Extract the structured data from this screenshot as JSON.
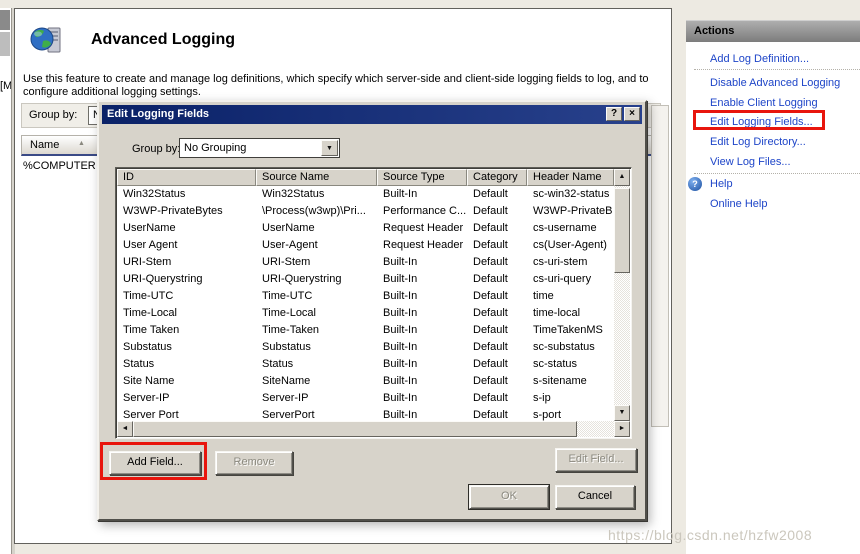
{
  "page": {
    "title": "Advanced Logging",
    "description_line1": "Use this feature to create and manage log definitions, which specify which server-side and client-side logging fields to log, and to",
    "description_line2": "configure additional logging settings.",
    "background": {
      "toolbar_label": "Group by:",
      "toolbar_value_partial": "N",
      "list_header": "Name",
      "first_row": "%COMPUTER",
      "tree_fragment": "[M"
    }
  },
  "dialog": {
    "title": "Edit Logging Fields",
    "group_by_label": "Group by:",
    "group_by_value": "No Grouping",
    "table": {
      "columns": [
        "ID",
        "Source Name",
        "Source Type",
        "Category",
        "Header Name"
      ],
      "rows": [
        [
          "Win32Status",
          "Win32Status",
          "Built-In",
          "Default",
          "sc-win32-status"
        ],
        [
          "W3WP-PrivateBytes",
          "\\Process(w3wp)\\Pri...",
          "Performance C...",
          "Default",
          "W3WP-PrivateB"
        ],
        [
          "UserName",
          "UserName",
          "Request Header",
          "Default",
          "cs-username"
        ],
        [
          "User Agent",
          "User-Agent",
          "Request Header",
          "Default",
          "cs(User-Agent)"
        ],
        [
          "URI-Stem",
          "URI-Stem",
          "Built-In",
          "Default",
          "cs-uri-stem"
        ],
        [
          "URI-Querystring",
          "URI-Querystring",
          "Built-In",
          "Default",
          "cs-uri-query"
        ],
        [
          "Time-UTC",
          "Time-UTC",
          "Built-In",
          "Default",
          "time"
        ],
        [
          "Time-Local",
          "Time-Local",
          "Built-In",
          "Default",
          "time-local"
        ],
        [
          "Time Taken",
          "Time-Taken",
          "Built-In",
          "Default",
          "TimeTakenMS"
        ],
        [
          "Substatus",
          "Substatus",
          "Built-In",
          "Default",
          "sc-substatus"
        ],
        [
          "Status",
          "Status",
          "Built-In",
          "Default",
          "sc-status"
        ],
        [
          "Site Name",
          "SiteName",
          "Built-In",
          "Default",
          "s-sitename"
        ],
        [
          "Server-IP",
          "Server-IP",
          "Built-In",
          "Default",
          "s-ip"
        ],
        [
          "Server Port",
          "ServerPort",
          "Built-In",
          "Default",
          "s-port"
        ]
      ]
    },
    "buttons": {
      "add_field": "Add Field...",
      "remove": "Remove",
      "edit_field": "Edit Field...",
      "ok": "OK",
      "cancel": "Cancel"
    }
  },
  "actions": {
    "header": "Actions",
    "add_log_definition": "Add Log Definition...",
    "disable_advanced_logging": "Disable Advanced Logging",
    "enable_client_logging": "Enable Client Logging",
    "edit_logging_fields": "Edit Logging Fields...",
    "edit_log_directory": "Edit Log Directory...",
    "view_log_files": "View Log Files...",
    "help": "Help",
    "online_help": "Online Help"
  },
  "icons": {
    "help_glyph": "?",
    "close_glyph": "×",
    "dropdown": "▼",
    "scroll_up": "▲",
    "scroll_down": "▼",
    "scroll_left": "◄",
    "scroll_right": "►",
    "sort_asc": "▲"
  },
  "watermark": "https://blog.csdn.net/hzfw2008",
  "colors": {
    "titlebar": "#0a2167",
    "link_blue": "#1e45c8",
    "highlight_red": "#e8150d",
    "dialog_face": "#d7d3ca",
    "background": "#edeae2"
  }
}
